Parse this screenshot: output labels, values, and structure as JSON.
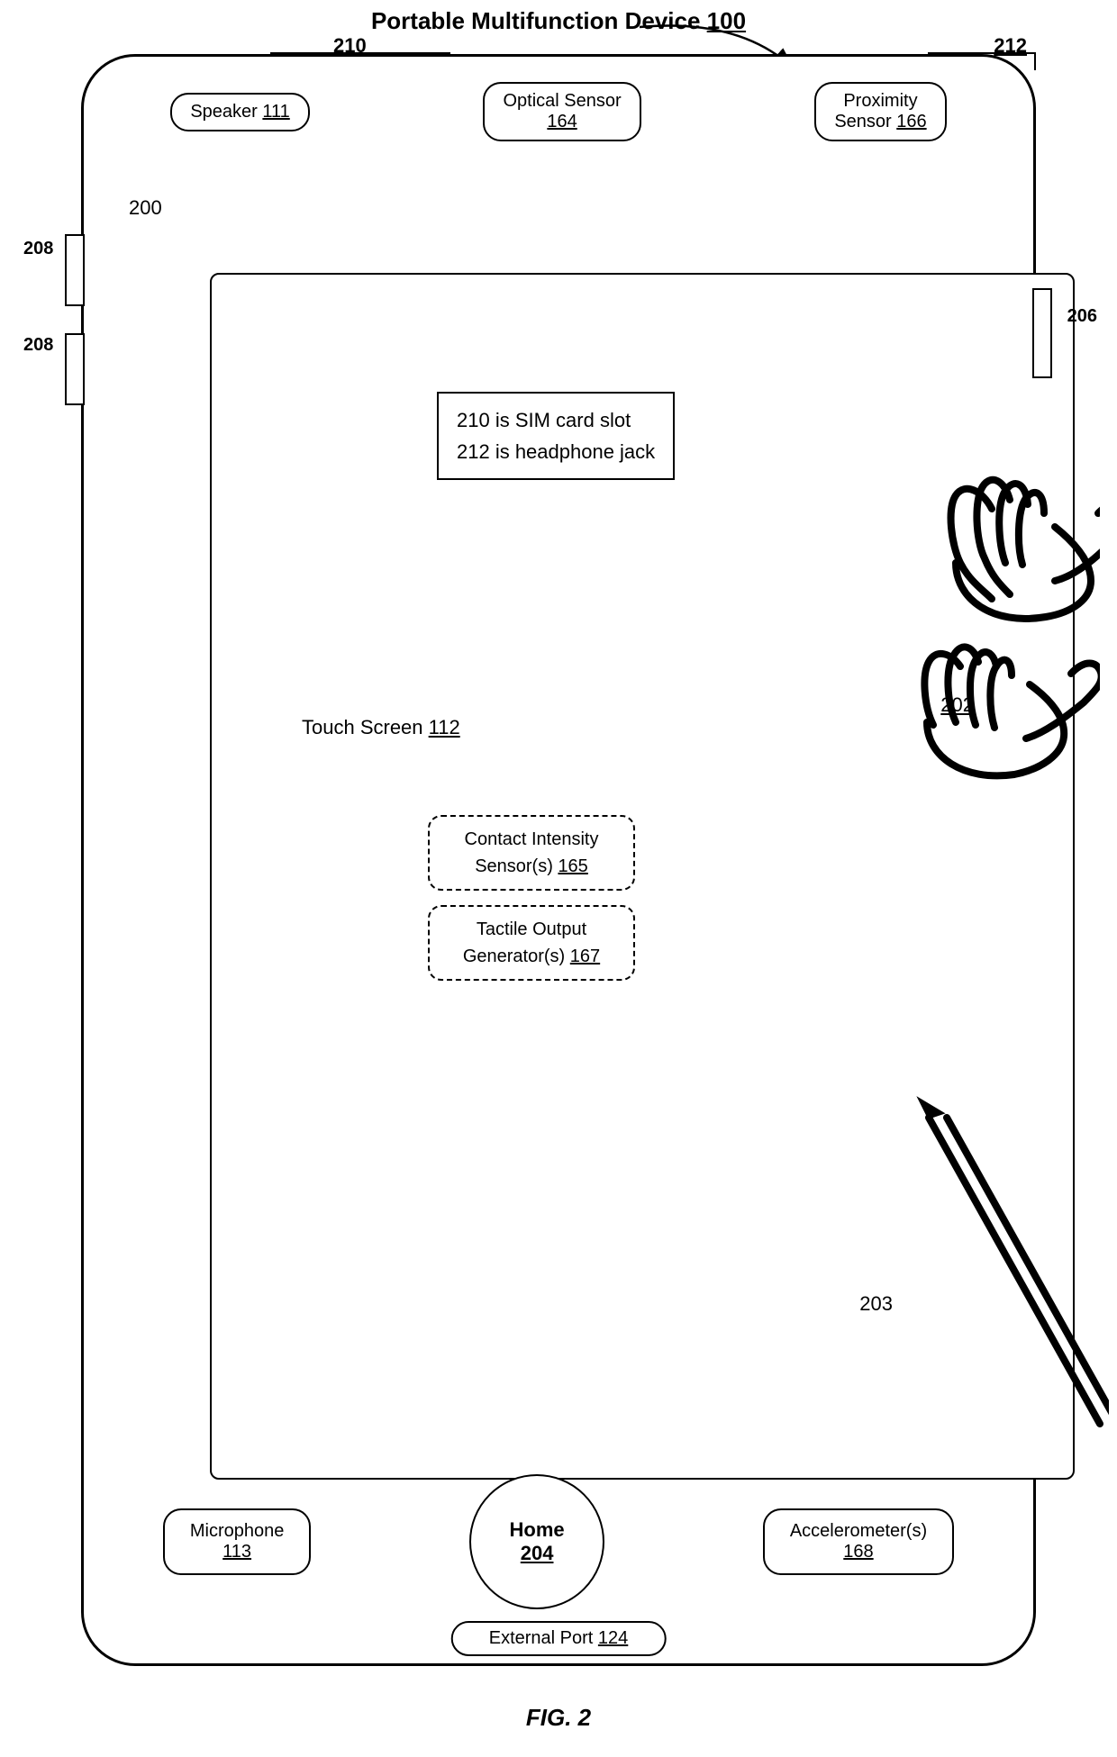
{
  "title": "Portable Multifunction Device 100",
  "title_label": "Portable Multifunction Device",
  "title_ref": "100",
  "top_slots": {
    "slot210": "210",
    "slot212": "212"
  },
  "side_labels": {
    "label208_1": "208",
    "label208_2": "208",
    "label206": "206",
    "label200": "200"
  },
  "top_components": [
    {
      "name": "Speaker",
      "ref": "111"
    },
    {
      "name": "Optical Sensor",
      "ref": "164"
    },
    {
      "name": "Proximity Sensor",
      "ref": "166"
    }
  ],
  "note_box": {
    "line1": "210 is SIM card slot",
    "line2": "212 is headphone jack"
  },
  "touch_screen": {
    "label": "Touch Screen",
    "ref": "112"
  },
  "contact_intensity": {
    "label": "Contact Intensity Sensor(s)",
    "ref": "165"
  },
  "tactile_output": {
    "label": "Tactile Output Generator(s)",
    "ref": "167"
  },
  "hand_label": {
    "ref": "202"
  },
  "stylus_label": {
    "ref": "203"
  },
  "bottom_components": [
    {
      "name": "Microphone",
      "ref": "113",
      "shape": "rounded"
    },
    {
      "name": "Home",
      "ref": "204",
      "shape": "circle"
    },
    {
      "name": "Accelerometer(s)",
      "ref": "168",
      "shape": "rounded"
    }
  ],
  "external_port": {
    "label": "External Port",
    "ref": "124"
  },
  "fig_caption": "FIG. 2"
}
